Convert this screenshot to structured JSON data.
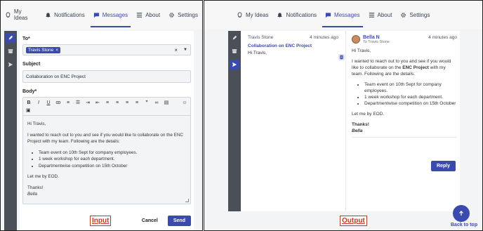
{
  "nav": {
    "items": [
      {
        "label": "My Ideas",
        "icon": "lightbulb-icon"
      },
      {
        "label": "Notifications",
        "icon": "bell-icon"
      },
      {
        "label": "Messages",
        "icon": "message-icon"
      },
      {
        "label": "About",
        "icon": "list-icon"
      },
      {
        "label": "Settings",
        "icon": "gear-icon"
      }
    ],
    "active": "Messages"
  },
  "compose": {
    "to_label": "To*",
    "recipient": "Travis Stone",
    "subject_label": "Subject",
    "subject_value": "Collaboration on ENC Project",
    "body_label": "Body*",
    "body": {
      "greeting": "Hi Travis,",
      "intro": "I wanted to reach out to you and see if you would like to collaborate on the ENC Project with my team. Following are the details:",
      "bullets": [
        "Team event on 10th Sept for company employees.",
        "1 week workshop for each department.",
        "Departmentwise competition on 15th October"
      ],
      "closing": "Let me by EOD.",
      "thanks": "Thanks!",
      "signature": "Bella"
    },
    "cancel_label": "Cancel",
    "send_label": "Send"
  },
  "labels": {
    "input": "Input",
    "output": "Output"
  },
  "inbox": {
    "item": {
      "sender": "Travis Stone",
      "time": "4 minutes ago",
      "subject": "Collaboration on ENC Project",
      "preview": "Hi Travis,"
    },
    "detail": {
      "sender": "Bella N",
      "to": "To Travis Stone",
      "time": "4 minutes ago",
      "greeting": "Hi Travis,",
      "intro_before": "I wanted to reach out to you and see if you would like to collaborate on the ",
      "intro_bold": "ENC Project",
      "intro_after": " with my team. Following are the details:",
      "bullets": [
        "Team event on 10th Sept for company employees.",
        "1 week workshop for each department.",
        "Departmentwise competition on 15th October"
      ],
      "closing": "Let me by EOD.",
      "thanks": "Thanks!",
      "signature": "Bella"
    },
    "reply_label": "Reply",
    "back_to_top": "Back to top"
  },
  "colors": {
    "accent": "#3b4aad",
    "sidebar": "#4b4f58",
    "tag_red": "#c0392b"
  }
}
